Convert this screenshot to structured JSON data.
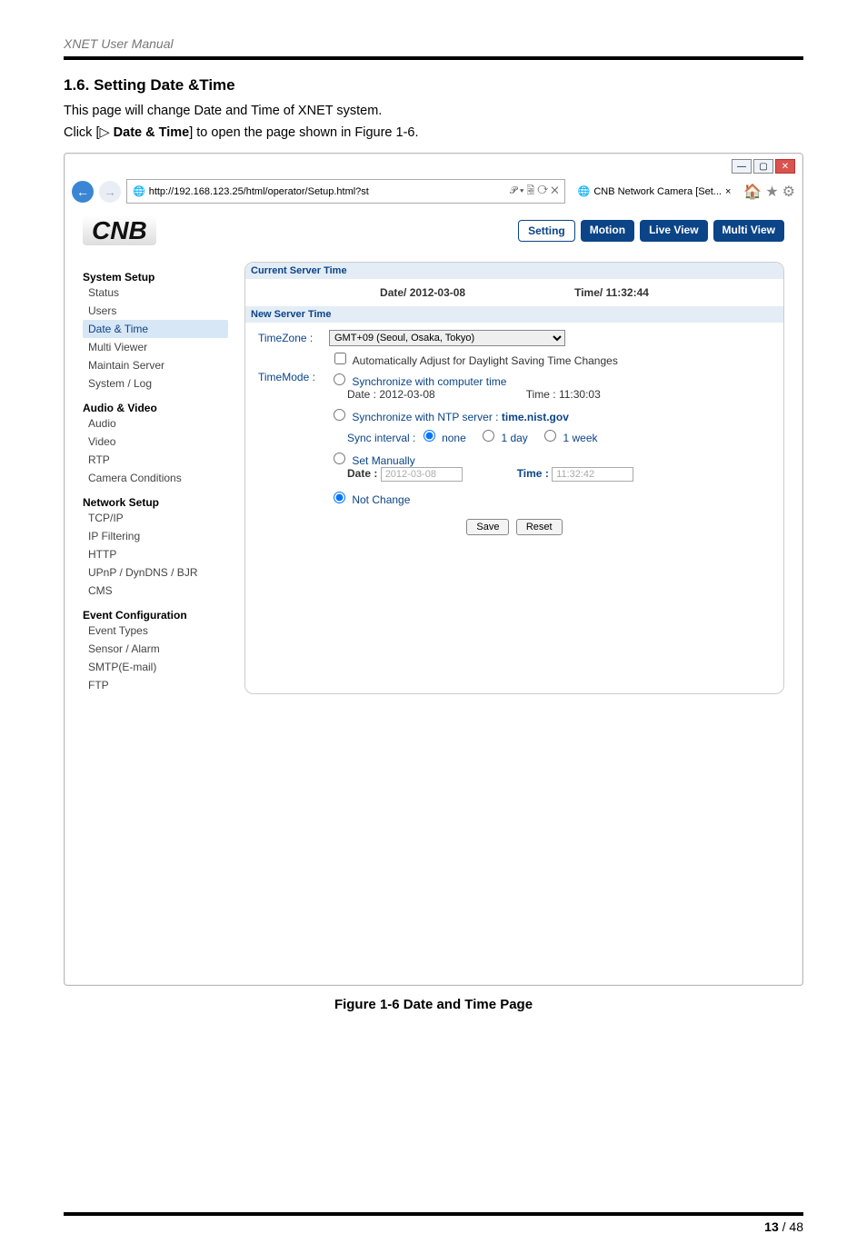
{
  "header": "XNET User Manual",
  "section_title": "1.6. Setting Date &Time",
  "intro_line1": "This page will change Date and Time of XNET system.",
  "intro_line2_pre": "Click [▷ ",
  "intro_line2_bold": "Date & Time",
  "intro_line2_post": "] to open the page shown in Figure 1-6.",
  "browser": {
    "url": "http://192.168.123.25/html/operator/Setup.html?st",
    "url_suffix": "𝒫 ▾ 🗟 ⟳ ✕",
    "tab_title": "CNB Network Camera [Set...",
    "tab_close": "×"
  },
  "app": {
    "logo": "CNB",
    "tabs": {
      "setting": "Setting",
      "motion": "Motion",
      "live": "Live View",
      "multi": "Multi View"
    }
  },
  "sidebar": {
    "g1": "System Setup",
    "g1_items": [
      "Status",
      "Users",
      "Date & Time",
      "Multi Viewer",
      "Maintain Server",
      "System / Log"
    ],
    "g2": "Audio & Video",
    "g2_items": [
      "Audio",
      "Video",
      "RTP",
      "Camera Conditions"
    ],
    "g3": "Network Setup",
    "g3_items": [
      "TCP/IP",
      "IP Filtering",
      "HTTP",
      "UPnP / DynDNS / BJR",
      "CMS"
    ],
    "g4": "Event Configuration",
    "g4_items": [
      "Event Types",
      "Sensor / Alarm",
      "SMTP(E-mail)",
      "FTP"
    ]
  },
  "panel": {
    "cst_header": "Current Server Time",
    "cst_date_label": "Date/ 2012-03-08",
    "cst_time_label": "Time/ 11:32:44",
    "nst_header": "New Server Time",
    "tz_label": "TimeZone :",
    "tz_value": "GMT+09 (Seoul, Osaka, Tokyo)",
    "dst": "Automatically Adjust for Daylight Saving Time Changes",
    "tm_label": "TimeMode :",
    "opt_sync_comp": "Synchronize with computer time",
    "comp_date": "Date : 2012-03-08",
    "comp_time": "Time : 11:30:03",
    "opt_sync_ntp_pre": "Synchronize with NTP server : ",
    "opt_sync_ntp_srv": "time.nist.gov",
    "sync_interval_label": "Sync interval :",
    "sync_none": "none",
    "sync_1day": "1 day",
    "sync_1week": "1 week",
    "opt_manual": "Set Manually",
    "man_date_label": "Date :",
    "man_date_val": "2012-03-08",
    "man_time_label": "Time :",
    "man_time_val": "11:32:42",
    "opt_nochange": "Not Change",
    "save": "Save",
    "reset": "Reset"
  },
  "figure_caption": "Figure 1-6 Date and Time Page",
  "page_number_bold": "13",
  "page_number_total": " / 48"
}
